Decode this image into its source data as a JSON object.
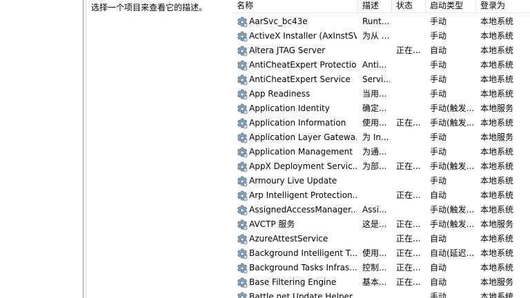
{
  "description_pane": {
    "text": "选择一个项目来查看它的描述。"
  },
  "columns": {
    "name": "名称",
    "description": "描述",
    "status": "状态",
    "startup_type": "启动类型",
    "logon_as": "登录为"
  },
  "icons": {
    "service": "gear-icon"
  },
  "services": [
    {
      "name": "AarSvc_bc43e",
      "description": "Runt...",
      "status": "",
      "startup": "手动",
      "logon": "本地系统"
    },
    {
      "name": "ActiveX Installer (AxInstSV)",
      "description": "为从 ...",
      "status": "",
      "startup": "手动",
      "logon": "本地系统"
    },
    {
      "name": "Altera JTAG Server",
      "description": "",
      "status": "正在...",
      "startup": "自动",
      "logon": "本地系统"
    },
    {
      "name": "AntiCheatExpert Protection",
      "description": "Anti...",
      "status": "",
      "startup": "手动",
      "logon": "本地系统"
    },
    {
      "name": "AntiCheatExpert Service",
      "description": "Servi...",
      "status": "",
      "startup": "手动",
      "logon": "本地系统"
    },
    {
      "name": "App Readiness",
      "description": "当用...",
      "status": "",
      "startup": "手动",
      "logon": "本地系统"
    },
    {
      "name": "Application Identity",
      "description": "确定...",
      "status": "",
      "startup": "手动(触发...",
      "logon": "本地服务"
    },
    {
      "name": "Application Information",
      "description": "使用...",
      "status": "正在...",
      "startup": "手动(触发...",
      "logon": "本地系统"
    },
    {
      "name": "Application Layer Gatewa...",
      "description": "为 In...",
      "status": "",
      "startup": "手动",
      "logon": "本地服务"
    },
    {
      "name": "Application Management",
      "description": "为通...",
      "status": "",
      "startup": "手动",
      "logon": "本地系统"
    },
    {
      "name": "AppX Deployment Servic...",
      "description": "为部...",
      "status": "正在...",
      "startup": "手动(触发...",
      "logon": "本地系统"
    },
    {
      "name": "Armoury Live Update",
      "description": "",
      "status": "",
      "startup": "手动",
      "logon": "本地系统"
    },
    {
      "name": "Arp Intelligent Protection...",
      "description": "",
      "status": "正在...",
      "startup": "自动",
      "logon": "本地系统"
    },
    {
      "name": "AssignedAccessManager...",
      "description": "Assi...",
      "status": "",
      "startup": "手动(触发...",
      "logon": "本地系统"
    },
    {
      "name": "AVCTP 服务",
      "description": "这是...",
      "status": "正在...",
      "startup": "手动(触发...",
      "logon": "本地服务"
    },
    {
      "name": "AzureAttestService",
      "description": "",
      "status": "正在...",
      "startup": "自动",
      "logon": "本地系统"
    },
    {
      "name": "Background Intelligent T...",
      "description": "使用...",
      "status": "正在...",
      "startup": "自动(延迟...",
      "logon": "本地系统"
    },
    {
      "name": "Background Tasks Infras...",
      "description": "控制...",
      "status": "正在...",
      "startup": "自动",
      "logon": "本地系统"
    },
    {
      "name": "Base Filtering Engine",
      "description": "基本...",
      "status": "正在...",
      "startup": "自动",
      "logon": "本地服务"
    },
    {
      "name": "Battle.net Update Helper ...",
      "description": "",
      "status": "",
      "startup": "手动",
      "logon": "本地系统"
    }
  ]
}
